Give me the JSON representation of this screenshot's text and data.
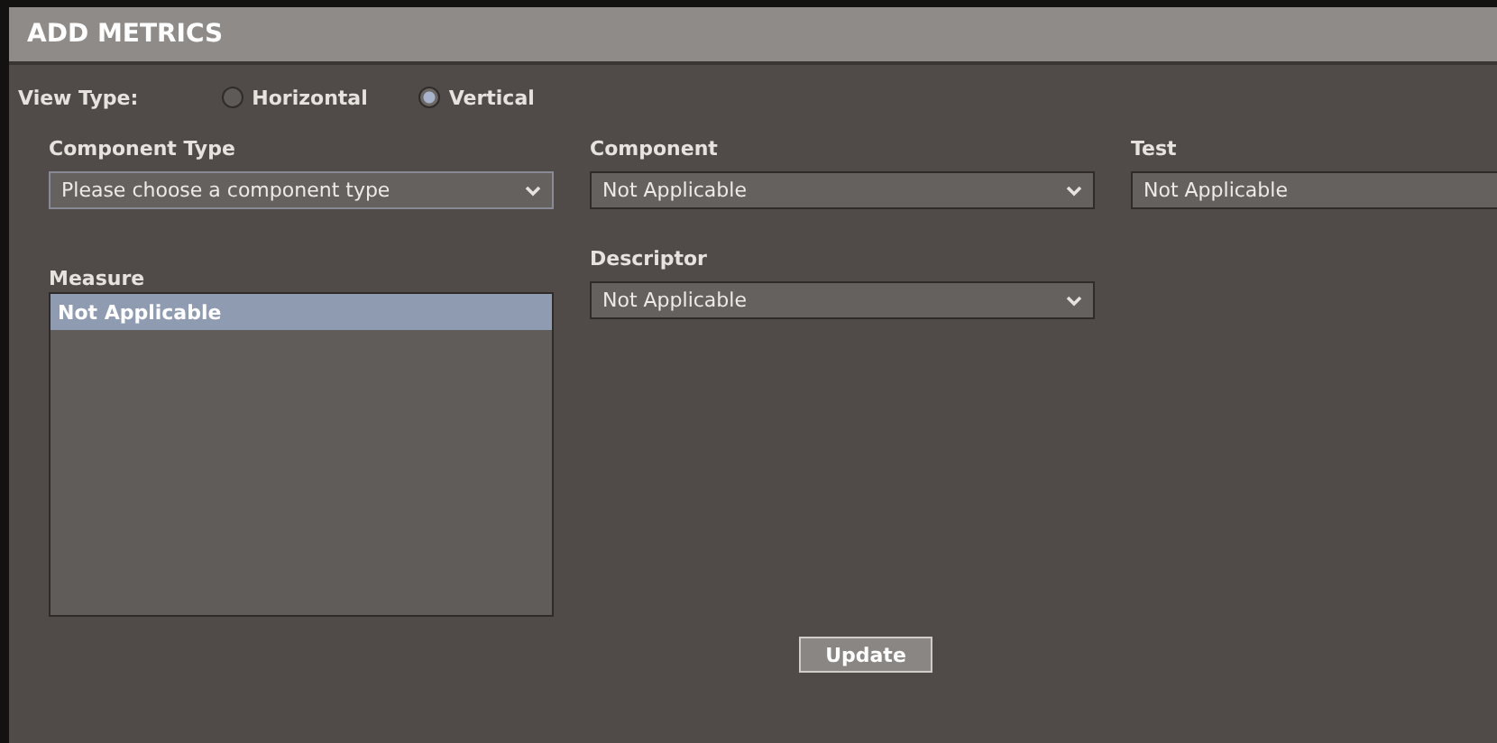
{
  "window": {
    "title": "ADD METRICS"
  },
  "view_type": {
    "label": "View Type:",
    "options": [
      {
        "label": "Horizontal",
        "selected": false
      },
      {
        "label": "Vertical",
        "selected": true
      }
    ]
  },
  "selects": [
    {
      "label": "Component Type",
      "value": "Please choose a component type"
    },
    {
      "label": "Component",
      "value": "Not Applicable"
    },
    {
      "label": "Test",
      "value": "Not Applicable"
    }
  ],
  "measure": {
    "label": "Measure",
    "items": [
      {
        "label": "Not Applicable",
        "selected": true
      }
    ]
  },
  "descriptor": {
    "label": "Descriptor",
    "value": "Not Applicable"
  },
  "buttons": [
    "Update"
  ]
}
